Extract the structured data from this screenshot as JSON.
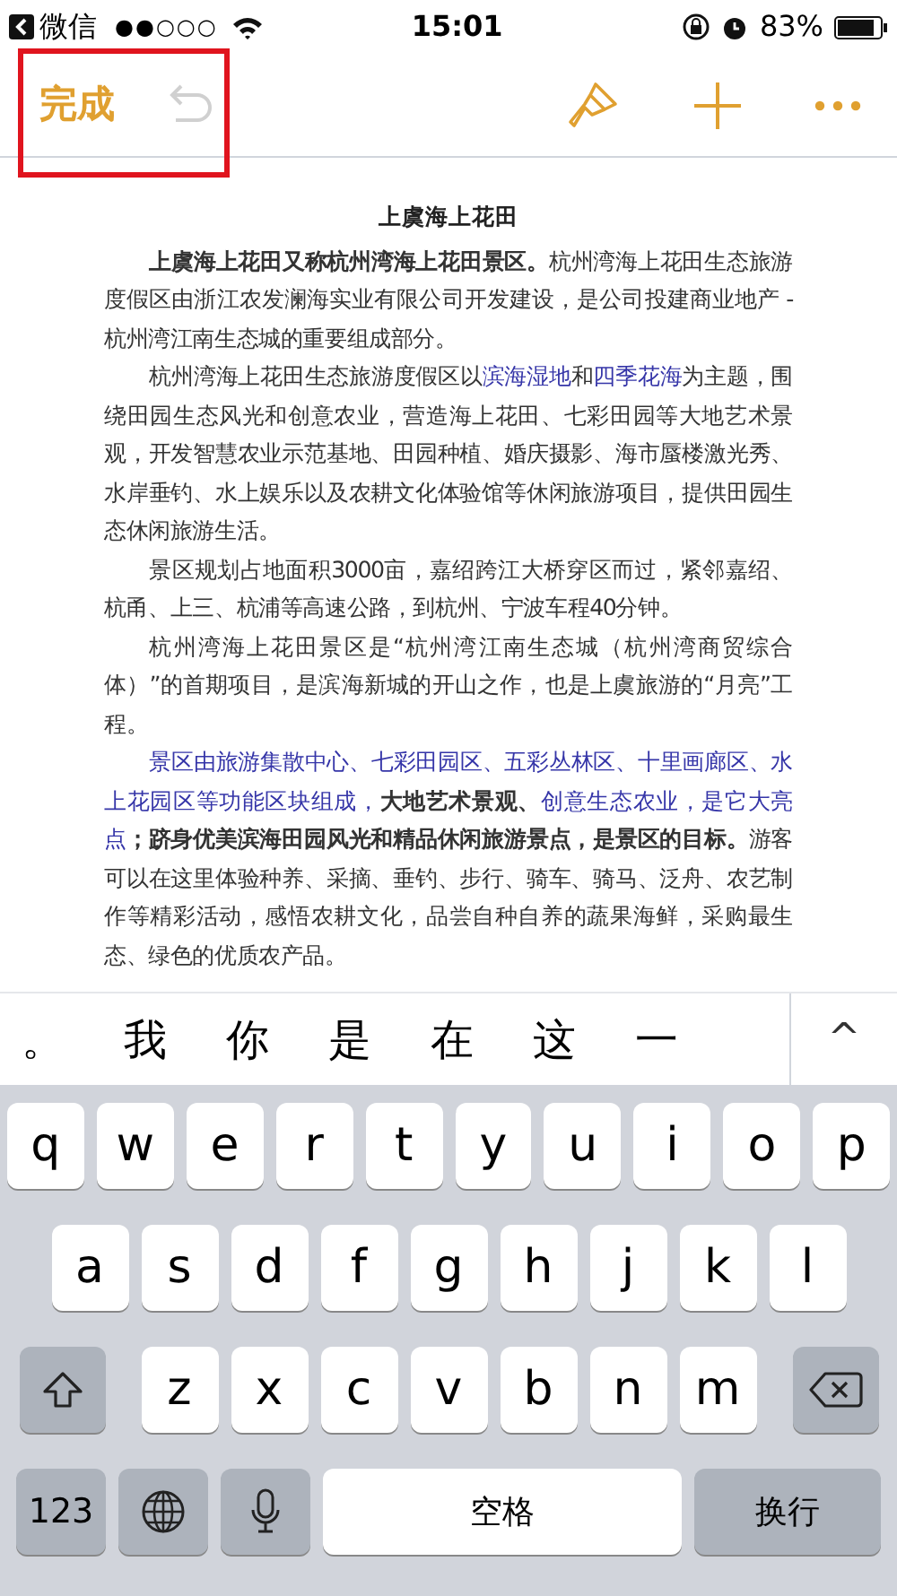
{
  "status_bar": {
    "back_app": "微信",
    "carrier_signal": "●●○○○",
    "time": "15:01",
    "battery": "83%"
  },
  "toolbar": {
    "done": "完成",
    "undo_disabled": true,
    "highlight_frame": true
  },
  "document": {
    "title": "上虞海上花田",
    "paragraphs": [
      [
        {
          "kind": "bold",
          "text": "上虞海上花田又称杭州湾海上花田景区。"
        },
        {
          "kind": "plain",
          "text": "杭州湾海上花田生态旅游度假区由浙江农发澜海实业有限公司开发建设，是公司投建商业地产 - 杭州湾江南生态城的重要组成部分。"
        }
      ],
      [
        {
          "kind": "plain",
          "text": "杭州湾海上花田生态旅游度假区以"
        },
        {
          "kind": "link",
          "text": "滨海湿地"
        },
        {
          "kind": "plain",
          "text": "和"
        },
        {
          "kind": "link",
          "text": "四季花海"
        },
        {
          "kind": "plain",
          "text": "为主题，围绕田园生态风光和创意农业，营造海上花田、七彩田园等大地艺术景观，开发智慧农业示范基地、田园种植、婚庆摄影、海市蜃楼激光秀、水岸垂钓、水上娱乐以及农耕文化体验馆等休闲旅游项目，提供田园生态休闲旅游生活。"
        }
      ],
      [
        {
          "kind": "plain",
          "text": "景区规划占地面积3000亩，嘉绍跨江大桥穿区而过，紧邻嘉绍、杭甬、上三、杭浦等高速公路，到杭州、宁波车程40分钟。"
        }
      ],
      [
        {
          "kind": "plain",
          "text": "杭州湾海上花田景区是“杭州湾江南生态城（杭州湾商贸综合体）”的首期项目，是滨海新城的开山之作，也是上虞旅游的“月亮”工程。"
        }
      ],
      [
        {
          "kind": "link",
          "text": "景区由旅游集散中心、七彩田园区、五彩丛林区、十里画廊区、水上花园区等功能区块组成，"
        },
        {
          "kind": "bold",
          "text": "大地艺术景观、"
        },
        {
          "kind": "link",
          "text": "创意生态农业，是它大亮点"
        },
        {
          "kind": "bold",
          "text": "；跻身优美滨海田园风光和精品休闲旅游景点，是景区的目标。"
        },
        {
          "kind": "plain",
          "text": "游客可以在这里体验种养、采摘、垂钓、步行、骑车、骑马、泛舟、农艺制作等精彩活动，感悟农耕文化，品尝自种自养的蔬果海鲜，采购最生态、绿色的优质农产品。"
        }
      ]
    ]
  },
  "candidates": {
    "items": [
      "。",
      "我",
      "你",
      "是",
      "在",
      "这",
      "一"
    ],
    "expand": "^"
  },
  "keyboard": {
    "key_rows": [
      [
        {
          "kind": "letter",
          "label": "q"
        },
        {
          "kind": "letter",
          "label": "w"
        },
        {
          "kind": "letter",
          "label": "e"
        },
        {
          "kind": "letter",
          "label": "r"
        },
        {
          "kind": "letter",
          "label": "t"
        },
        {
          "kind": "letter",
          "label": "y"
        },
        {
          "kind": "letter",
          "label": "u"
        },
        {
          "kind": "letter",
          "label": "i"
        },
        {
          "kind": "letter",
          "label": "o"
        },
        {
          "kind": "letter",
          "label": "p"
        }
      ],
      [
        {
          "kind": "letter",
          "label": "a"
        },
        {
          "kind": "letter",
          "label": "s"
        },
        {
          "kind": "letter",
          "label": "d"
        },
        {
          "kind": "letter",
          "label": "f"
        },
        {
          "kind": "letter",
          "label": "g"
        },
        {
          "kind": "letter",
          "label": "h"
        },
        {
          "kind": "letter",
          "label": "j"
        },
        {
          "kind": "letter",
          "label": "k"
        },
        {
          "kind": "letter",
          "label": "l"
        }
      ],
      [
        {
          "kind": "shift"
        },
        {
          "kind": "letter",
          "label": "z"
        },
        {
          "kind": "letter",
          "label": "x"
        },
        {
          "kind": "letter",
          "label": "c"
        },
        {
          "kind": "letter",
          "label": "v"
        },
        {
          "kind": "letter",
          "label": "b"
        },
        {
          "kind": "letter",
          "label": "n"
        },
        {
          "kind": "letter",
          "label": "m"
        },
        {
          "kind": "delete"
        }
      ]
    ],
    "bottom_row": {
      "numbers": "123",
      "space": "空格",
      "return": "换行"
    }
  }
}
